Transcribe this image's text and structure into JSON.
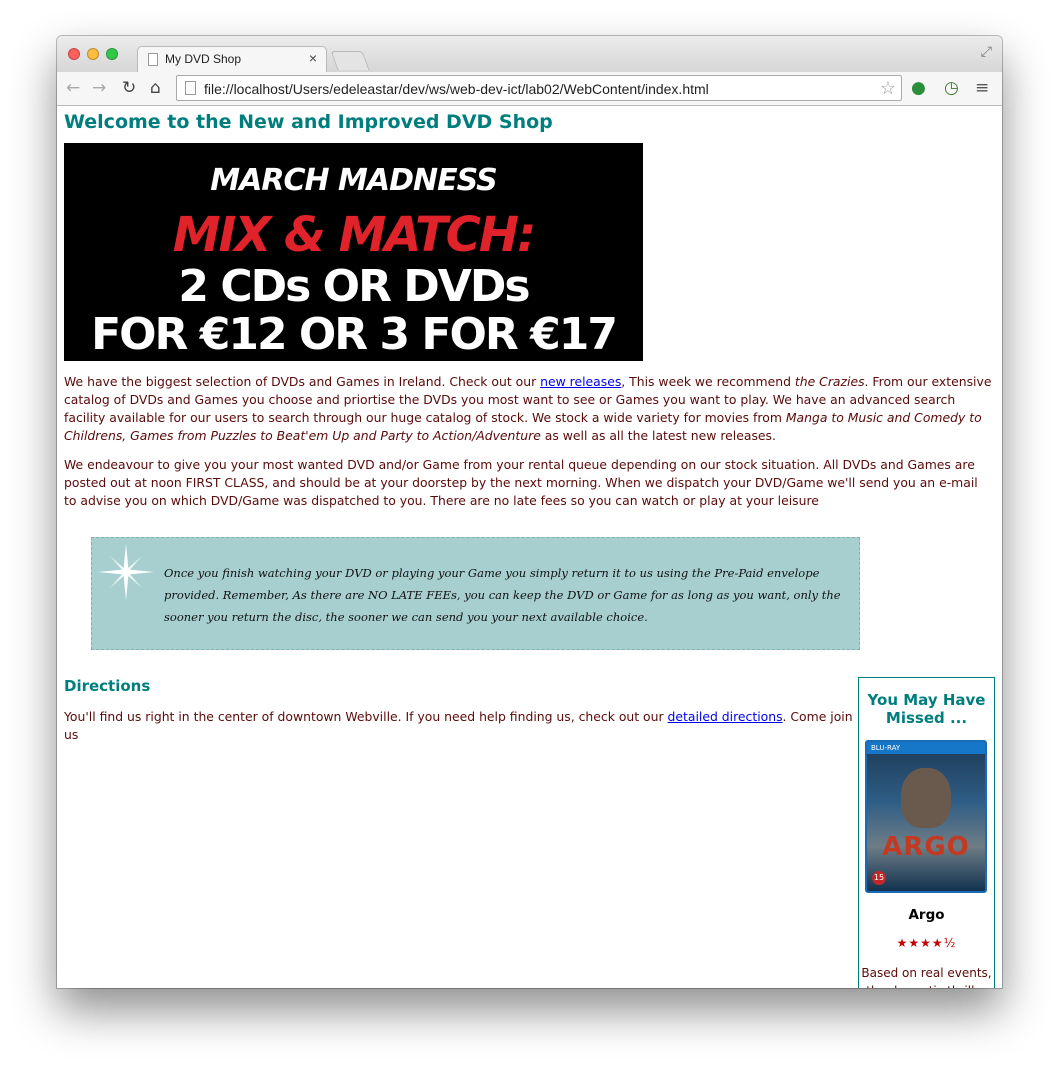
{
  "browser": {
    "tab_title": "My DVD Shop",
    "tab_close": "×",
    "url": "file://localhost/Users/edeleastar/dev/ws/web-dev-ict/lab02/WebContent/index.html",
    "back_icon": "←",
    "forward_icon": "→",
    "reload_icon": "↻",
    "home_icon": "⌂",
    "star_icon": "☆",
    "fullscreen_icon": "⤢",
    "extension_icon": "●",
    "history_icon": "◷",
    "menu_icon": "≡"
  },
  "page": {
    "heading": "Welcome to the New and Improved DVD Shop",
    "banner": {
      "line1": "MARCH MADNESS",
      "line2": "MIX & MATCH:",
      "line3": "2 CDs OR DVDs",
      "line4": "FOR €12 OR 3 FOR €17"
    },
    "intro": {
      "p1_a": "We have the biggest selection of DVDs and Games in Ireland. Check out our ",
      "p1_link": "new releases",
      "p1_b": ", This week we recommend ",
      "p1_em1": "the Crazies",
      "p1_c": ". From our extensive catalog of DVDs and Games you choose and priortise the DVDs you most want to see or Games you want to play. We have an advanced search facility available for our users to search through our huge catalog of stock. We stock a wide variety for movies from ",
      "p1_em2": "Manga to Music and Comedy to Childrens, Games from Puzzles to Beat'em Up and Party to Action/Adventure",
      "p1_d": " as well as all the latest new releases."
    },
    "shipping": "We endeavour to give you your most wanted DVD and/or Game from your rental queue depending on our stock situation. All DVDs and Games are posted out at noon FIRST CLASS, and should be at your doorstep by the next morning. When we dispatch your DVD/Game we'll send you an e-mail to advise you on which DVD/Game was dispatched to you. There are no late fees so you can watch or play at your leisure",
    "note": "Once you finish watching your DVD or playing your Game you simply return it to us using the Pre-Paid envelope provided. Remember, As there are NO LATE FEEs, you can keep the DVD or Game for as long as you want, only the sooner you return the disc, the sooner we can send you your next available choice.",
    "directions_heading": "Directions",
    "directions": {
      "a": "You'll find us right in the center of downtown Webville. If you need help finding us, check out our ",
      "link": "detailed directions",
      "b": ". Come join us"
    }
  },
  "sidebar": {
    "heading": "You May Have Missed ...",
    "cover_label": "BLU-RAY",
    "cover_title": "ARGO",
    "cover_rating": "15",
    "movie_title": "Argo",
    "stars": "★★★★½",
    "rating_fraction": 0.9,
    "blurb": "Based on real events, the dramatic thriller"
  }
}
